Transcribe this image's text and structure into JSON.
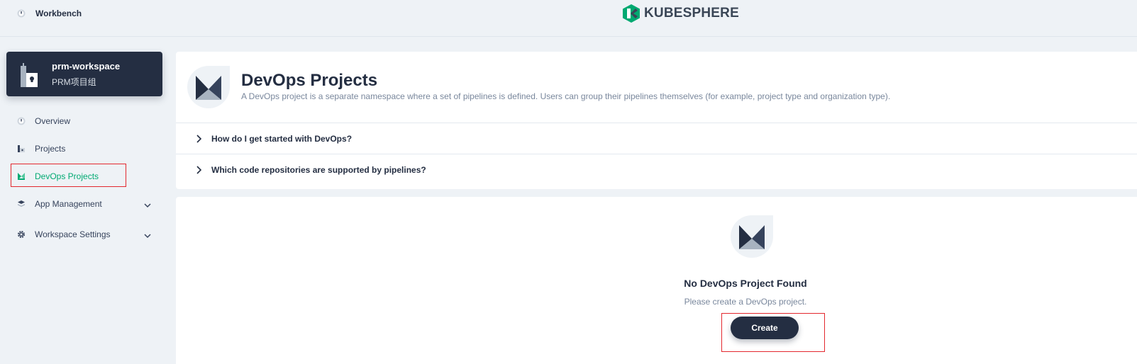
{
  "topbar": {
    "workbench_label": "Workbench",
    "logo_text": "KUBESPHERE"
  },
  "workspace": {
    "name": "prm-workspace",
    "description": "PRM项目组"
  },
  "sidebar": {
    "items": [
      {
        "label": "Overview",
        "icon": "dashboard-icon"
      },
      {
        "label": "Projects",
        "icon": "project-icon"
      },
      {
        "label": "DevOps Projects",
        "icon": "devops-icon",
        "active": true
      },
      {
        "label": "App Management",
        "icon": "appcenter-icon",
        "expandable": true
      },
      {
        "label": "Workspace Settings",
        "icon": "gear-icon",
        "expandable": true
      }
    ]
  },
  "header": {
    "title": "DevOps Projects",
    "description": "A DevOps project is a separate namespace where a set of pipelines is defined. Users can group their pipelines themselves (for example, project type and organization type).",
    "faqs": [
      "How do I get started with DevOps?",
      "Which code repositories are supported by pipelines?"
    ]
  },
  "empty_state": {
    "title": "No DevOps Project Found",
    "description": "Please create a DevOps project.",
    "button_label": "Create"
  },
  "colors": {
    "accent": "#00aa72",
    "dark": "#242e42",
    "highlight": "#e3282e"
  }
}
